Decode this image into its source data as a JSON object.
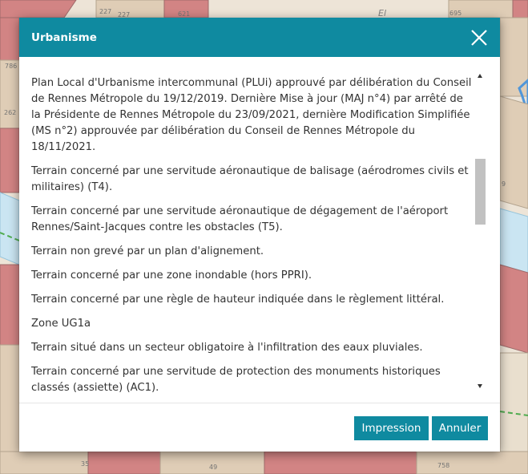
{
  "map": {
    "parcel_labels": [
      "227",
      "227",
      "621",
      "695",
      "786",
      "262",
      "9",
      "35",
      "49",
      "758"
    ],
    "street_label": "El"
  },
  "dialog": {
    "title": "Urbanisme",
    "paragraphs": [
      "Plan Local d'Urbanisme intercommunal (PLUi) approuvé par délibération du Conseil de Rennes Métropole du 19/12/2019. Dernière Mise à jour (MAJ n°4) par arrêté de la Présidente de Rennes Métropole du 23/09/2021, dernière Modification Simplifiée (MS n°2) approuvée par délibération du Conseil de Rennes Métropole du 18/11/2021.",
      "Terrain concerné par une servitude aéronautique de balisage (aérodromes civils et militaires) (T4).",
      "Terrain concerné par une servitude aéronautique de dégagement de l'aéroport Rennes/Saint-Jacques contre les obstacles (T5).",
      "Terrain non grevé par un plan d'alignement.",
      "Terrain concerné par une zone inondable (hors PPRI).",
      "Terrain concerné par une règle de hauteur indiquée dans le règlement littéral.",
      "Zone UG1a",
      "Terrain situé dans un secteur obligatoire à l'infiltration des eaux pluviales.",
      "Terrain concerné par une servitude de protection des monuments historiques classés (assiette) (AC1)."
    ],
    "buttons": {
      "print_label": "Impression",
      "cancel_label": "Annuler"
    },
    "icons": {
      "close": "close-icon",
      "scroll_up": "scroll-up-arrow-icon",
      "scroll_down": "scroll-down-arrow-icon"
    }
  },
  "colors": {
    "header": "#0f8aa0",
    "button": "#0f8aa0",
    "text": "#333333",
    "scroll_thumb": "#c1c1c1"
  }
}
